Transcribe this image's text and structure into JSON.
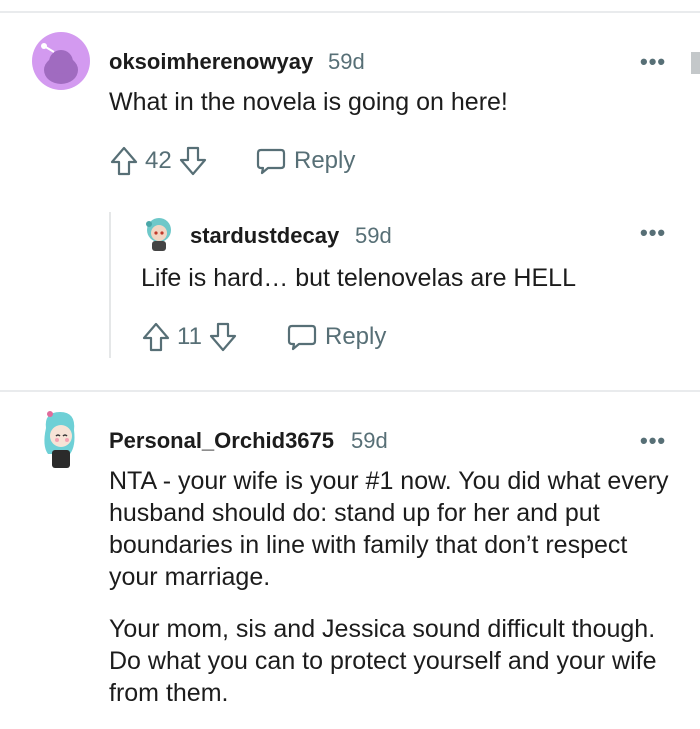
{
  "comments": [
    {
      "username": "oksoimherenowyay",
      "age": "59d",
      "text": "What in the novela is going on here!",
      "votes": "42",
      "reply_label": "Reply"
    },
    {
      "username": "stardustdecay",
      "age": "59d",
      "text": "Life is hard… but telenovelas are HELL",
      "votes": "11",
      "reply_label": "Reply"
    },
    {
      "username": "Personal_Orchid3675",
      "age": "59d",
      "paragraphs": [
        "NTA - your wife is your #1 now. You did what every husband should do: stand up for her and put boundaries in line with family that don’t respect your marriage.",
        "Your mom, sis and Jessica sound difficult though. Do what you can to protect yourself and your wife from them."
      ]
    }
  ],
  "more_label": "•••",
  "colors": {
    "meta": "#576f76",
    "divider": "#e9ebed",
    "avatar_bg": "#d39af0"
  },
  "icons": [
    "upvote-icon",
    "downvote-icon",
    "reply-bubble-icon",
    "more-options-icon",
    "avatar"
  ]
}
